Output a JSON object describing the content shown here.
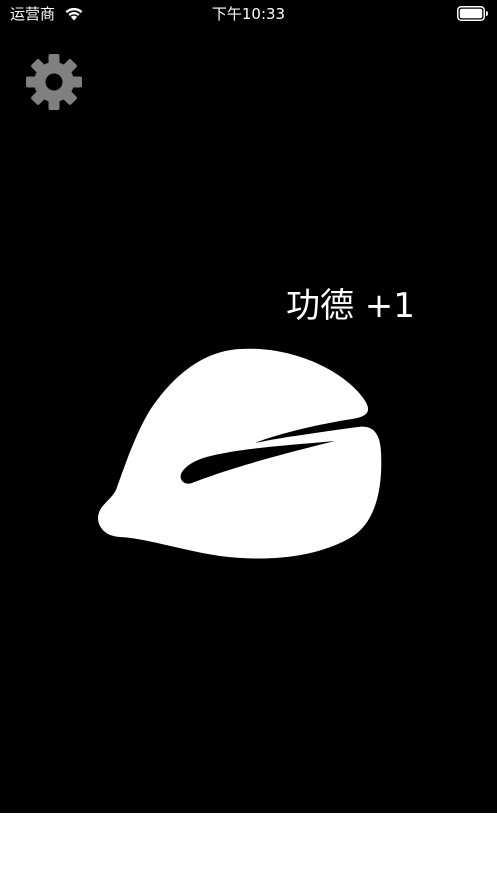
{
  "status_bar": {
    "carrier": "运营商",
    "time": "下午10:33",
    "wifi_icon": "wifi-icon",
    "battery_icon": "battery-icon"
  },
  "settings": {
    "icon": "gear-icon"
  },
  "merit_text": "功德 +1",
  "wooden_fish": {
    "icon": "wooden-fish-icon"
  },
  "colors": {
    "background": "#000000",
    "foreground": "#ffffff",
    "gear": "#808080",
    "bottom_area": "#ffffff"
  }
}
